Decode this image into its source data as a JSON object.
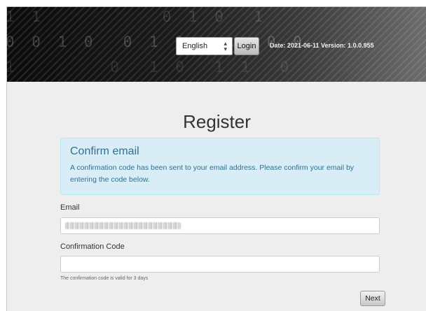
{
  "header": {
    "binary_rows": [
      "1 1         0 1 0  1",
      "0 0 1 0  0 1 1      0 0",
      "1       0  1 0  1 1  0"
    ],
    "language": {
      "selected": "English"
    },
    "login_label": "Login",
    "version_info": "Date: 2021-06-11  Version: 1.0.0.955"
  },
  "main": {
    "title": "Register",
    "alert": {
      "title": "Confirm email",
      "text": "A confirmation code has been sent to your email address. Please confirm your email by entering the code below."
    },
    "email": {
      "label": "Email",
      "value": ""
    },
    "code": {
      "label": "Confirmation Code",
      "value": "",
      "help": "The confirmation code is valid for 3 days"
    },
    "next_label": "Next"
  },
  "colors": {
    "alert_bg": "#d9edf7",
    "alert_text": "#31708f",
    "page_bg": "#eeeeee"
  }
}
